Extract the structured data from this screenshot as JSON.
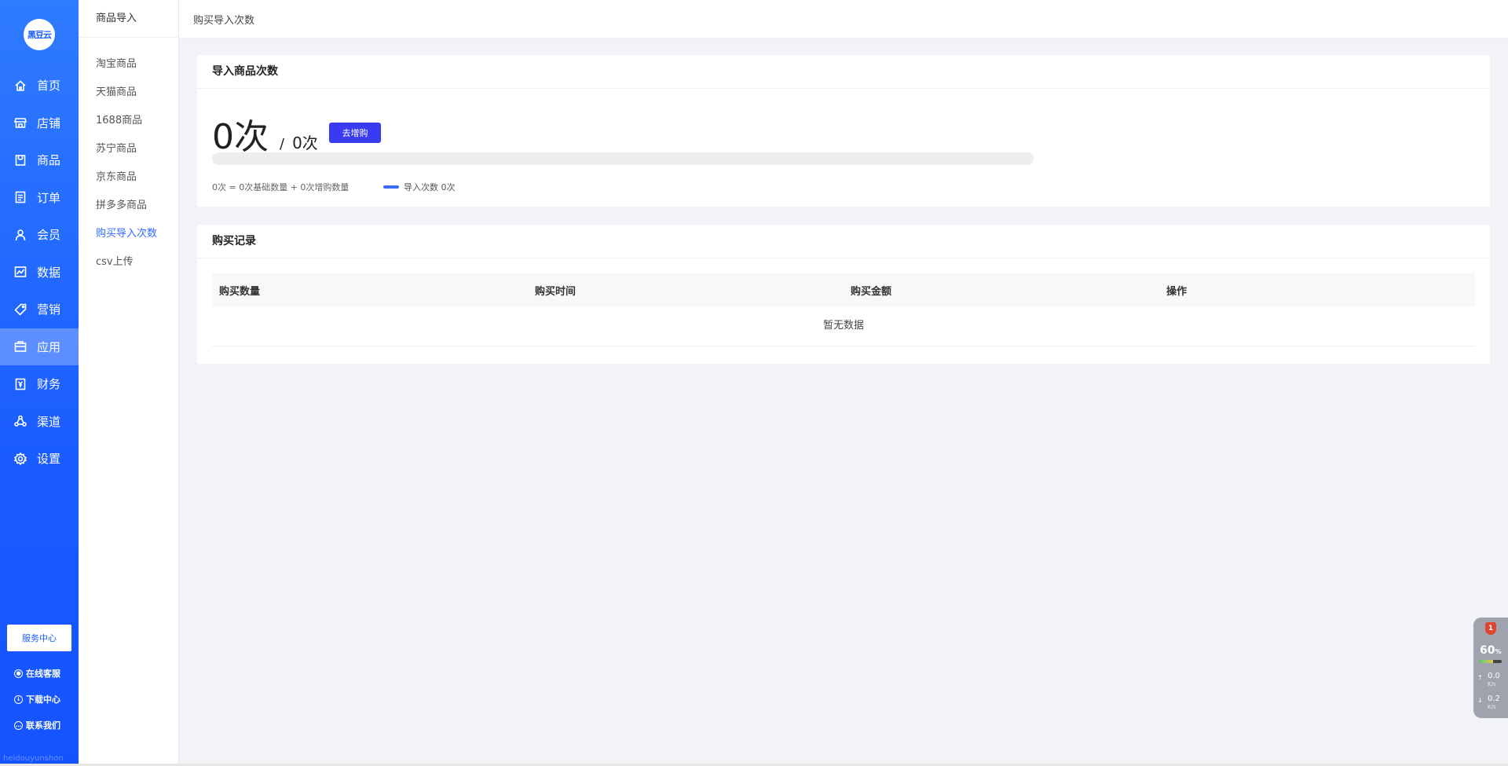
{
  "sidebar": {
    "logo_text": "黑豆云",
    "items": [
      {
        "label": "首页",
        "icon": "home-icon"
      },
      {
        "label": "店铺",
        "icon": "store-icon"
      },
      {
        "label": "商品",
        "icon": "goods-icon"
      },
      {
        "label": "订单",
        "icon": "order-icon"
      },
      {
        "label": "会员",
        "icon": "member-icon"
      },
      {
        "label": "数据",
        "icon": "chart-icon"
      },
      {
        "label": "营销",
        "icon": "tag-icon"
      },
      {
        "label": "应用",
        "icon": "app-icon",
        "active": true
      },
      {
        "label": "财务",
        "icon": "finance-icon"
      },
      {
        "label": "渠道",
        "icon": "channel-icon"
      },
      {
        "label": "设置",
        "icon": "gear-icon"
      }
    ],
    "service_center": "服务中心",
    "online_support": "在线客服",
    "download_center": "下载中心",
    "contact_us": "联系我们",
    "domain_text": "heidouyunshon"
  },
  "subnav": {
    "title": "商品导入",
    "items": [
      "淘宝商品",
      "天猫商品",
      "1688商品",
      "苏宁商品",
      "京东商品",
      "拼多多商品",
      "购买导入次数",
      "csv上传"
    ],
    "active_index": 6
  },
  "breadcrumb": "购买导入次数",
  "import_card": {
    "title": "导入商品次数",
    "used": "0次",
    "separator": "/",
    "total": "0次",
    "buy_button": "去增购",
    "progress": 0,
    "formula": "0次 = 0次基础数量 + 0次增购数量",
    "legend": "导入次数 0次"
  },
  "records_card": {
    "title": "购买记录",
    "columns": [
      "购买数量",
      "购买时间",
      "购买金额",
      "操作"
    ],
    "empty_text": "暂无数据"
  },
  "monitor": {
    "badge": "1",
    "percent": "60",
    "percent_unit": "%",
    "upload": "0.0",
    "download": "0.2",
    "unit": "K/s"
  },
  "colors": {
    "primary": "#1a5cff",
    "accent_button": "#3a3af0",
    "active_link": "#2f6bff"
  }
}
